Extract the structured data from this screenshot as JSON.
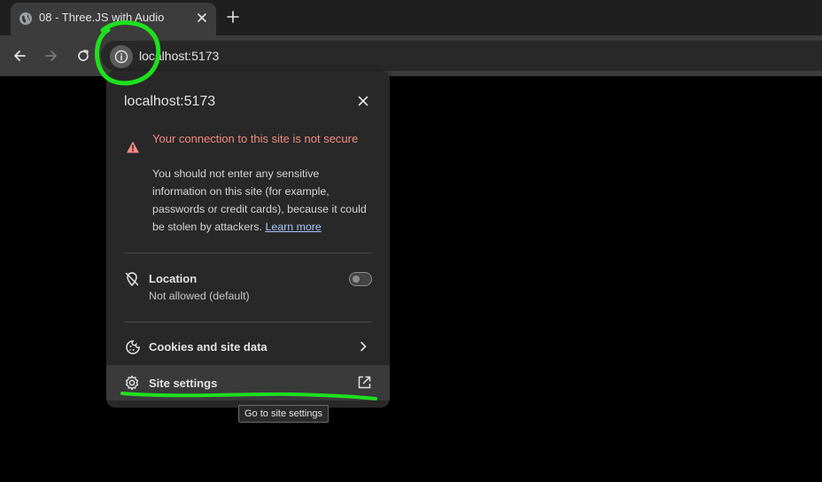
{
  "tab": {
    "title": "08 - Three.JS with Audio",
    "favicon": "globe-icon"
  },
  "toolbar": {
    "url": "localhost:5173"
  },
  "popup": {
    "host": "localhost:5173",
    "warning": {
      "title": "Your connection to this site is not secure",
      "body": "You should not enter any sensitive information on this site (for example, passwords or credit cards), because it could be stolen by attackers.",
      "link": "Learn more"
    },
    "location": {
      "label": "Location",
      "value": "Not allowed (default)",
      "enabled": false
    },
    "cookies": {
      "label": "Cookies and site data"
    },
    "site_settings": {
      "label": "Site settings"
    }
  },
  "tooltip": {
    "text": "Go to site settings"
  },
  "colors": {
    "warning": "#f28b82",
    "link": "#a8c7fa",
    "annotation": "#1ee01e"
  }
}
